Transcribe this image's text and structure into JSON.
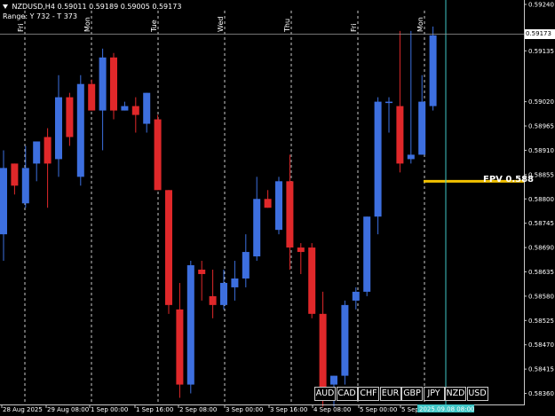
{
  "header": {
    "symbol_line": "NZDUSD,H4  0.59011 0.59189 0.59005 0.59173",
    "range_line": "Range: Y 732 - T 373",
    "menu_icon": "triangle-down-icon"
  },
  "price_axis": {
    "labels": [
      "0.59240",
      "0.59173",
      "0.59135",
      "0.59020",
      "0.58965",
      "0.58910",
      "0.58855",
      "0.58800",
      "0.58745",
      "0.58690",
      "0.58635",
      "0.58580",
      "0.58525",
      "0.58470",
      "0.58415",
      "0.58360"
    ],
    "current_price": "0.59173"
  },
  "time_axis": {
    "labels": [
      "28 Aug 2025",
      "29 Aug 08:00",
      "1 Sep 00:00",
      "1 Sep 16:00",
      "2 Sep 08:00",
      "3 Sep 00:00",
      "3 Sep 16:00",
      "4 Sep 08:00",
      "5 Sep 00:00",
      "5 Sep 16:00"
    ],
    "cursor_time": "2025.09.08 08:00"
  },
  "day_separators": [
    "Fri",
    "Mon",
    "Tue",
    "Wed",
    "Thu",
    "Fri",
    "Mon"
  ],
  "fpv_label": "FPV 0.588",
  "symbol_buttons": [
    "AUD",
    "CAD",
    "CHF",
    "EUR",
    "GBP",
    "JPY",
    "NZD",
    "USD"
  ],
  "colors": {
    "bull": "#3d6fdf",
    "bear": "#e0282a",
    "fpv_line": "#f2c200",
    "crosshair": "#3fc6c6",
    "separator": "#c8c8c8",
    "background": "#000000"
  },
  "chart_data": {
    "type": "candlestick",
    "symbol": "NZDUSD",
    "timeframe": "H4",
    "ylim": [
      0.58335,
      0.5925
    ],
    "fpv_level": 0.5884,
    "candles": [
      {
        "o": 0.5872,
        "h": 0.5891,
        "l": 0.5866,
        "c": 0.5887
      },
      {
        "o": 0.5888,
        "h": 0.5888,
        "l": 0.5881,
        "c": 0.5883
      },
      {
        "o": 0.5879,
        "h": 0.5892,
        "l": 0.5878,
        "c": 0.5887
      },
      {
        "o": 0.5888,
        "h": 0.5893,
        "l": 0.5884,
        "c": 0.5893
      },
      {
        "o": 0.5894,
        "h": 0.5896,
        "l": 0.5878,
        "c": 0.5888
      },
      {
        "o": 0.5889,
        "h": 0.5908,
        "l": 0.5885,
        "c": 0.5903
      },
      {
        "o": 0.5903,
        "h": 0.5904,
        "l": 0.5892,
        "c": 0.5894
      },
      {
        "o": 0.5885,
        "h": 0.5908,
        "l": 0.5883,
        "c": 0.5906
      },
      {
        "o": 0.5906,
        "h": 0.5907,
        "l": 0.59,
        "c": 0.59
      },
      {
        "o": 0.59,
        "h": 0.5914,
        "l": 0.5891,
        "c": 0.5912
      },
      {
        "o": 0.5912,
        "h": 0.5913,
        "l": 0.5898,
        "c": 0.59
      },
      {
        "o": 0.59,
        "h": 0.5902,
        "l": 0.59,
        "c": 0.5901
      },
      {
        "o": 0.5901,
        "h": 0.5903,
        "l": 0.5895,
        "c": 0.5899
      },
      {
        "o": 0.5897,
        "h": 0.5904,
        "l": 0.5895,
        "c": 0.5904
      },
      {
        "o": 0.5898,
        "h": 0.5899,
        "l": 0.5882,
        "c": 0.5882
      },
      {
        "o": 0.5882,
        "h": 0.5882,
        "l": 0.5854,
        "c": 0.5856
      },
      {
        "o": 0.5855,
        "h": 0.5861,
        "l": 0.5835,
        "c": 0.5838
      },
      {
        "o": 0.5838,
        "h": 0.5866,
        "l": 0.5836,
        "c": 0.5865
      },
      {
        "o": 0.5864,
        "h": 0.5866,
        "l": 0.5857,
        "c": 0.5863
      },
      {
        "o": 0.5858,
        "h": 0.5864,
        "l": 0.5853,
        "c": 0.5856
      },
      {
        "o": 0.5856,
        "h": 0.5864,
        "l": 0.5855,
        "c": 0.5861
      },
      {
        "o": 0.586,
        "h": 0.5866,
        "l": 0.5857,
        "c": 0.5862
      },
      {
        "o": 0.5862,
        "h": 0.5872,
        "l": 0.586,
        "c": 0.5868
      },
      {
        "o": 0.5867,
        "h": 0.5885,
        "l": 0.5866,
        "c": 0.588
      },
      {
        "o": 0.588,
        "h": 0.5882,
        "l": 0.5878,
        "c": 0.5878
      },
      {
        "o": 0.5873,
        "h": 0.5885,
        "l": 0.5872,
        "c": 0.5884
      },
      {
        "o": 0.5884,
        "h": 0.589,
        "l": 0.5864,
        "c": 0.5869
      },
      {
        "o": 0.5869,
        "h": 0.587,
        "l": 0.5863,
        "c": 0.5868
      },
      {
        "o": 0.5869,
        "h": 0.587,
        "l": 0.5853,
        "c": 0.5854
      },
      {
        "o": 0.5854,
        "h": 0.5859,
        "l": 0.5833,
        "c": 0.5835
      },
      {
        "o": 0.5838,
        "h": 0.584,
        "l": 0.5833,
        "c": 0.584
      },
      {
        "o": 0.584,
        "h": 0.5857,
        "l": 0.5838,
        "c": 0.5856
      },
      {
        "o": 0.5857,
        "h": 0.586,
        "l": 0.5855,
        "c": 0.5859
      },
      {
        "o": 0.5859,
        "h": 0.5876,
        "l": 0.5858,
        "c": 0.5876
      },
      {
        "o": 0.5876,
        "h": 0.5903,
        "l": 0.5872,
        "c": 0.5902
      },
      {
        "o": 0.5902,
        "h": 0.5903,
        "l": 0.5895,
        "c": 0.5902
      },
      {
        "o": 0.5901,
        "h": 0.5918,
        "l": 0.5886,
        "c": 0.5888
      },
      {
        "o": 0.5889,
        "h": 0.5918,
        "l": 0.5888,
        "c": 0.589
      },
      {
        "o": 0.589,
        "h": 0.5908,
        "l": 0.589,
        "c": 0.5902
      },
      {
        "o": 0.5901,
        "h": 0.5919,
        "l": 0.59,
        "c": 0.5917
      }
    ]
  }
}
